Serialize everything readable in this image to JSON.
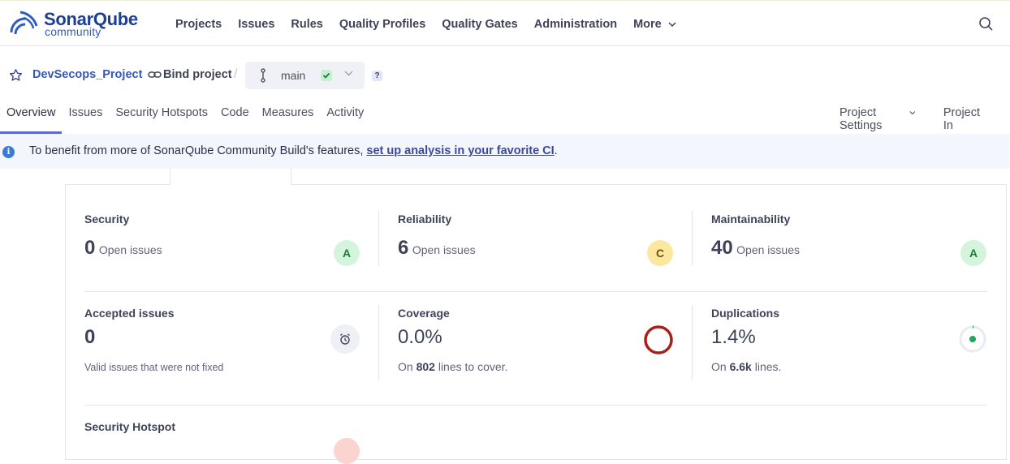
{
  "logo": {
    "word": "SonarQube",
    "sub": "community"
  },
  "nav": {
    "items": [
      "Projects",
      "Issues",
      "Rules",
      "Quality Profiles",
      "Quality Gates",
      "Administration"
    ],
    "more": "More"
  },
  "project": {
    "name": "DevSecops_Project",
    "bind_label": "Bind project",
    "branch": "main",
    "help": "?"
  },
  "tabs": [
    "Overview",
    "Issues",
    "Security Hotspots",
    "Code",
    "Measures",
    "Activity"
  ],
  "tabs_right": {
    "settings": "Project Settings",
    "info": "Project In"
  },
  "banner": {
    "text": "To benefit from more of SonarQube Community Build's features, ",
    "link": "set up analysis in your favorite CI",
    "end": "."
  },
  "metrics": {
    "security": {
      "title": "Security",
      "value": "0",
      "suffix": "Open issues",
      "rating": "A"
    },
    "reliability": {
      "title": "Reliability",
      "value": "6",
      "suffix": "Open issues",
      "rating": "C"
    },
    "maintainability": {
      "title": "Maintainability",
      "value": "40",
      "suffix": "Open issues",
      "rating": "A"
    },
    "accepted": {
      "title": "Accepted issues",
      "value": "0",
      "note": "Valid issues that were not fixed"
    },
    "coverage": {
      "title": "Coverage",
      "value": "0.0%",
      "note_pre": "On",
      "lines": "802",
      "note_post": "lines to cover."
    },
    "duplications": {
      "title": "Duplications",
      "value": "1.4%",
      "note_pre": "On",
      "lines": "6.6k",
      "note_post": "lines."
    },
    "hotspot": {
      "title": "Security Hotspot"
    }
  },
  "colors": {
    "rating_a_bg": "#d4f5dc",
    "rating_a_fg": "#1f7a3a",
    "rating_c_bg": "#fbe7a0",
    "rating_c_fg": "#6b5400",
    "coverage_ring": "#a8201a",
    "dup_green": "#20a858",
    "accent": "#5f6bd0"
  }
}
